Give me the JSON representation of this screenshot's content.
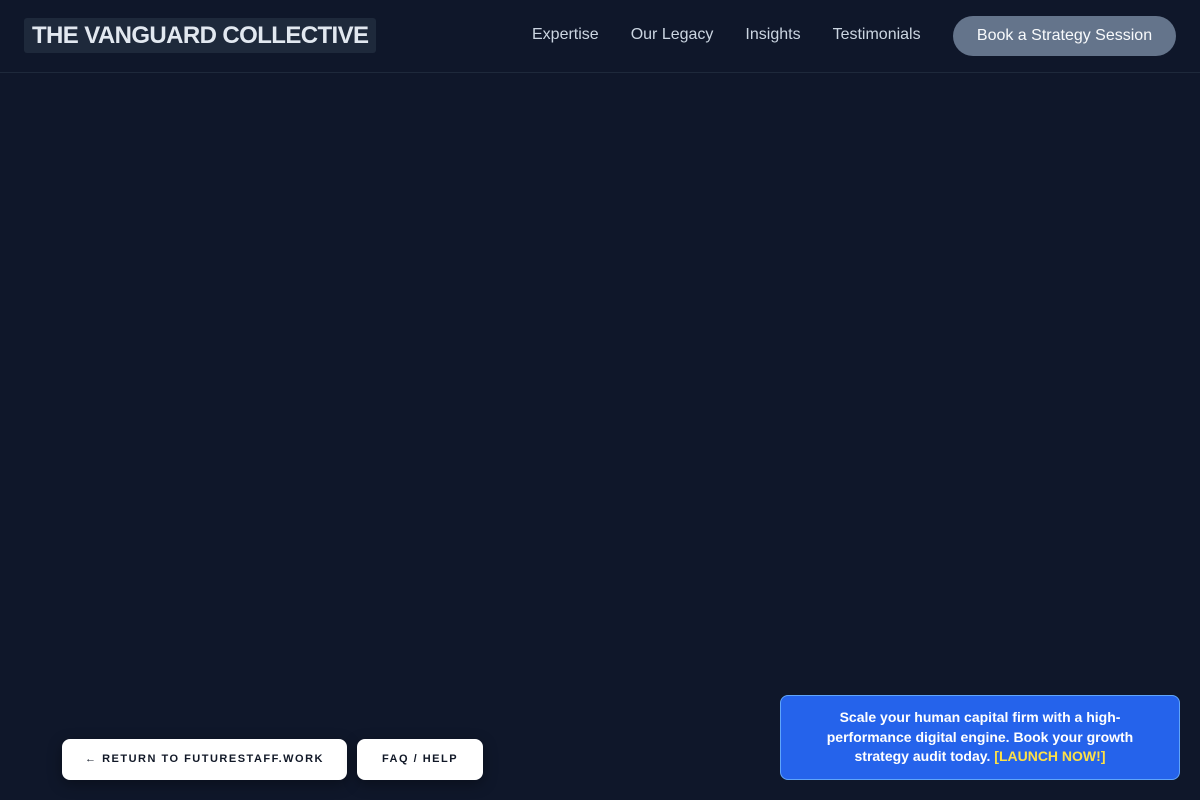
{
  "header": {
    "logo": "THE VANGUARD COLLECTIVE",
    "nav": [
      {
        "label": "Expertise"
      },
      {
        "label": "Our Legacy"
      },
      {
        "label": "Insights"
      },
      {
        "label": "Testimonials"
      }
    ],
    "cta_label": "Book a Strategy Session"
  },
  "footer_buttons": {
    "return_label": "← RETURN TO FUTURESTAFF.WORK",
    "faq_label": "FAQ / HELP"
  },
  "promo": {
    "text": "Scale your human capital firm with a high-performance digital engine. Book your growth strategy audit today.",
    "link_label": "[LAUNCH NOW!]"
  },
  "colors": {
    "background": "#0f172a",
    "cta": "#64748b",
    "promo": "#2563eb",
    "promo_link": "#fde047"
  }
}
